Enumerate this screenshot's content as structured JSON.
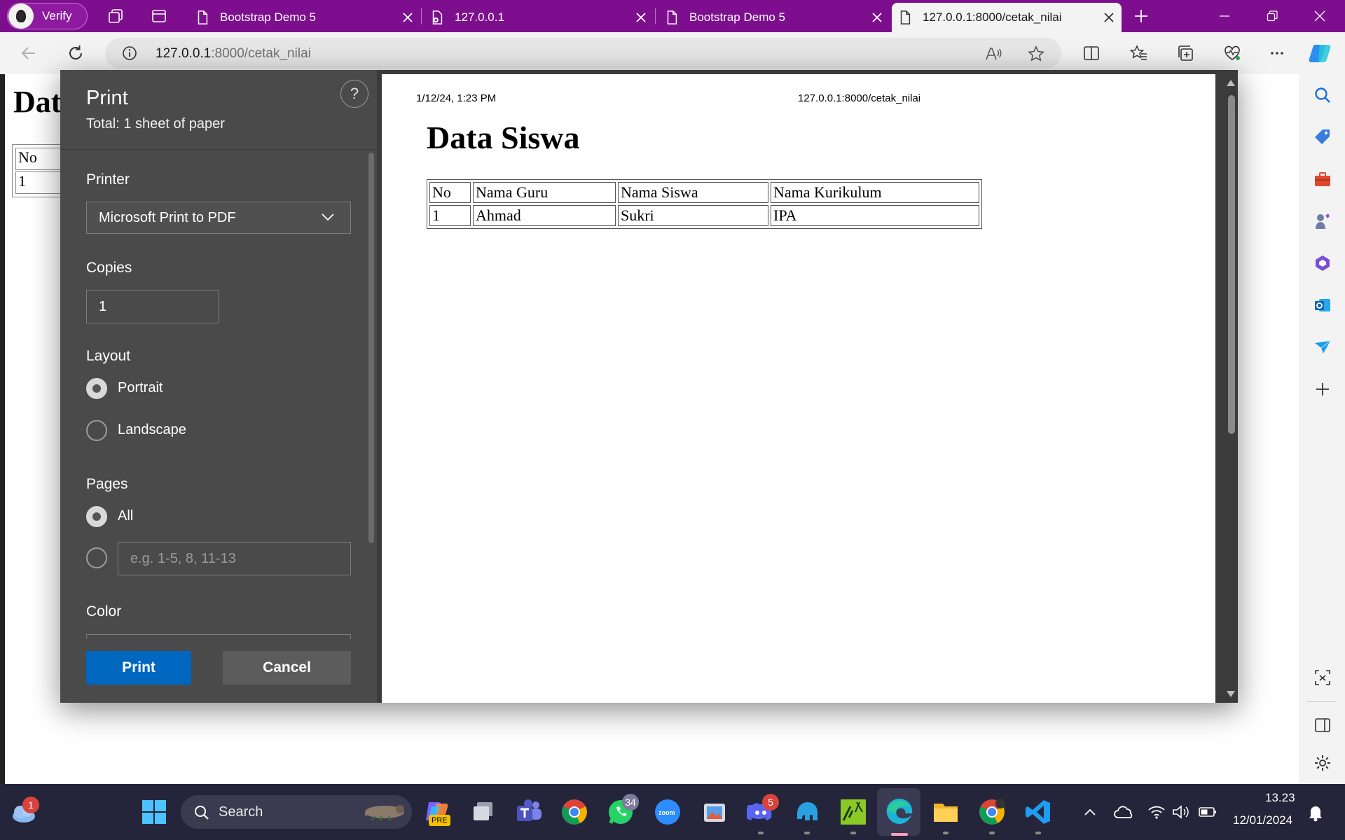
{
  "browser": {
    "profile_label": "Verify",
    "tabs": [
      {
        "title": "Bootstrap Demo 5"
      },
      {
        "title": "127.0.0.1"
      },
      {
        "title": "Bootstrap Demo 5"
      },
      {
        "title": "127.0.0.1:8000/cetak_nilai"
      }
    ],
    "url_host": "127.0.0.1",
    "url_rest": ":8000/cetak_nilai"
  },
  "background_page": {
    "title_fragment": "Dat",
    "cells": [
      "No",
      "1"
    ]
  },
  "print_dialog": {
    "title": "Print",
    "total": "Total: 1 sheet of paper",
    "help": "?",
    "printer_label": "Printer",
    "printer_value": "Microsoft Print to PDF",
    "copies_label": "Copies",
    "copies_value": "1",
    "layout_label": "Layout",
    "layout_options": [
      "Portrait",
      "Landscape"
    ],
    "layout_selected": "Portrait",
    "pages_label": "Pages",
    "pages_all": "All",
    "pages_placeholder": "e.g. 1-5, 8, 11-13",
    "color_label": "Color",
    "print_button": "Print",
    "cancel_button": "Cancel"
  },
  "preview": {
    "header_date": "1/12/24, 1:23 PM",
    "header_url": "127.0.0.1:8000/cetak_nilai",
    "title": "Data Siswa",
    "columns": [
      "No",
      "Nama Guru",
      "Nama Siswa",
      "Nama Kurikulum"
    ],
    "rows": [
      [
        "1",
        "Ahmad",
        "Sukri",
        "IPA"
      ]
    ]
  },
  "taskbar": {
    "search_label": "Search",
    "weather_badge": "1",
    "whatsapp_badge": "34",
    "discord_badge": "5",
    "zoom_label": "zoom",
    "copilot_badge": "PRE",
    "time": "13.23",
    "date": "12/01/2024"
  },
  "colors": {
    "tab_strip": "#7d0f8e",
    "print_button": "#0067c0",
    "taskbar": "#24253a"
  }
}
